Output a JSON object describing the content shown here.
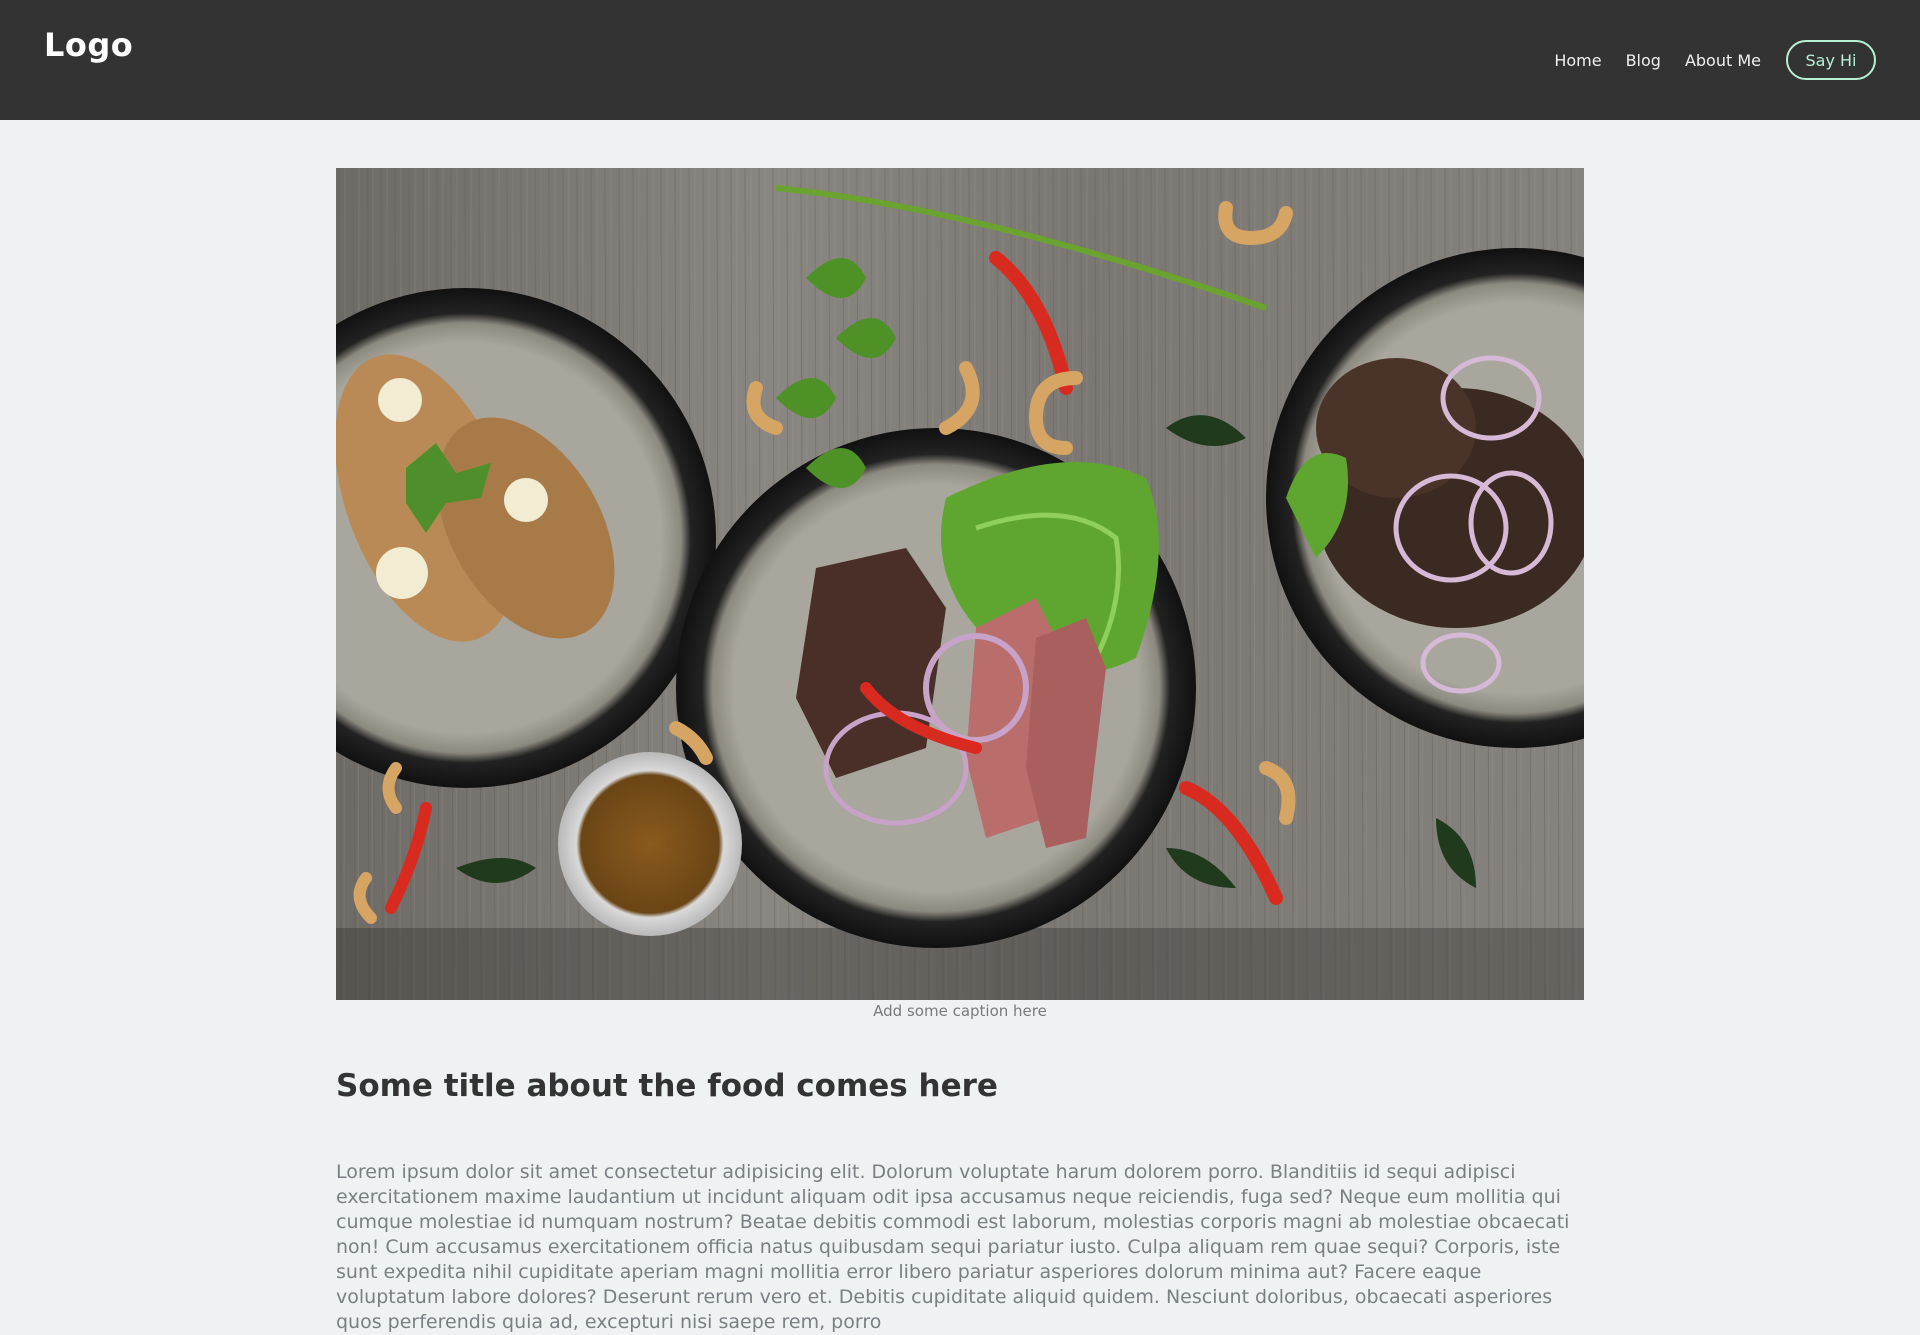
{
  "header": {
    "logo": "Logo",
    "nav": [
      "Home",
      "Blog",
      "About Me"
    ],
    "cta_label": "Say Hi"
  },
  "colors": {
    "header_bg": "#333333",
    "page_bg": "#eef2f3",
    "accent": "#b4f1d5",
    "title": "#333333",
    "body_text": "#7a7f84"
  },
  "hero": {
    "caption": "Add some caption here"
  },
  "article": {
    "title": "Some title about the food comes here",
    "body": "Lorem ipsum dolor sit amet consectetur adipisicing elit. Dolorum voluptate harum dolorem porro. Blanditiis id sequi adipisci exercitationem maxime laudantium ut incidunt aliquam odit ipsa accusamus neque reiciendis, fuga sed? Neque eum mollitia qui cumque molestiae id numquam nostrum? Beatae debitis commodi est laborum, molestias corporis magni ab molestiae obcaecati non! Cum accusamus exercitationem officia natus quibusdam sequi pariatur iusto. Culpa aliquam rem quae sequi? Corporis, iste sunt expedita nihil cupiditate aperiam magni mollitia error libero pariatur asperiores dolorum minima aut? Facere eaque voluptatum labore dolores? Deserunt rerum vero et. Debitis cupiditate aliquid quidem. Nesciunt doloribus, obcaecati asperiores quos perferendis quia ad, excepturi nisi saepe rem, porro"
  }
}
